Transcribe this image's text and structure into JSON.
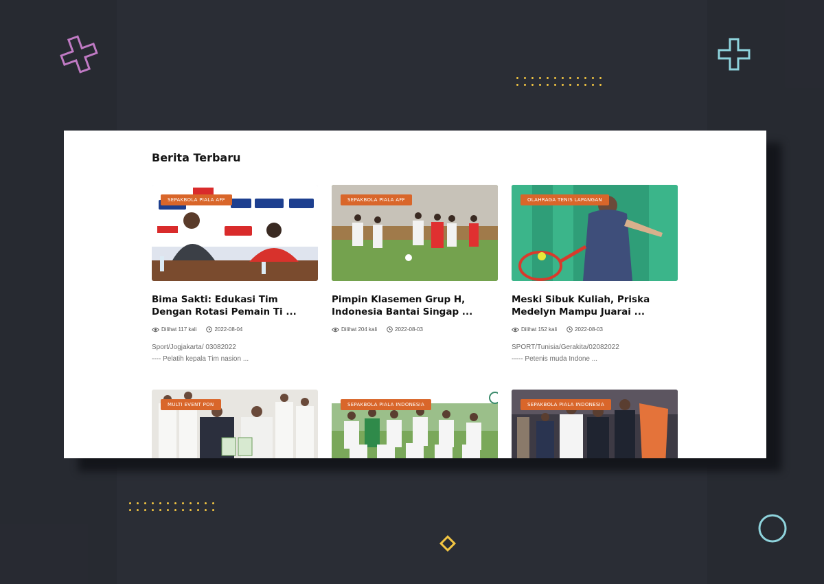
{
  "section": {
    "title": "Berita Terbaru"
  },
  "accent": "#d9662a",
  "articles": [
    {
      "category": "SEPAKBOLA PIALA AFF",
      "title": "Bima Sakti: Edukasi Tim Dengan Rotasi Pemain Ti ...",
      "views": "Dilihat 117 kali",
      "date": "2022-08-04",
      "excerpt_line1": "Sport/Jogjakarta/ 03082022",
      "excerpt_line2": "---- Pelatih kepala Tim nasion ..."
    },
    {
      "category": "SEPAKBOLA PIALA AFF",
      "title": "Pimpin Klasemen Grup H, Indonesia Bantai Singap ...",
      "views": "Dilihat 204 kali",
      "date": "2022-08-03",
      "excerpt_line1": "",
      "excerpt_line2": ""
    },
    {
      "category": "OLAHRAGA TENIS LAPANGAN",
      "title": "Meski Sibuk Kuliah, Priska Medelyn Mampu Juarai ...",
      "views": "Dilihat 152 kali",
      "date": "2022-08-03",
      "excerpt_line1": "SPORT/Tunisia/Gerakita/02082022",
      "excerpt_line2": "----- Petenis muda Indone ..."
    },
    {
      "category": "MULTI EVENT PON"
    },
    {
      "category": "SEPAKBOLA PIALA INDONESIA"
    },
    {
      "category": "SEPAKBOLA PIALA INDONESIA"
    }
  ]
}
